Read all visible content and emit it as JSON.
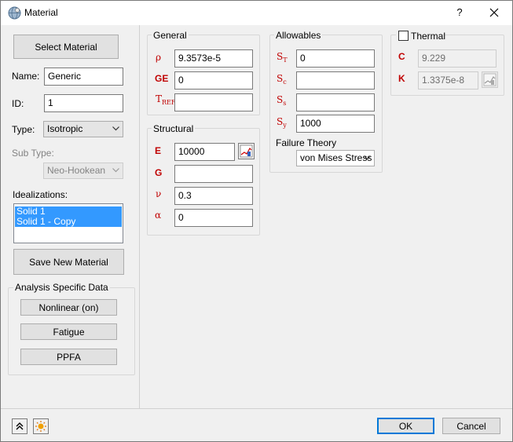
{
  "window": {
    "title": "Material",
    "help_glyph": "?"
  },
  "left": {
    "select_material_label": "Select Material",
    "name_label": "Name:",
    "name_value": "Generic",
    "id_label": "ID:",
    "id_value": "1",
    "type_label": "Type:",
    "type_value": "Isotropic",
    "subtype_label": "Sub Type:",
    "subtype_value": "Neo-Hookean",
    "idealizations_label": "Idealizations:",
    "idealizations": [
      "Solid 1",
      "Solid 1 - Copy"
    ],
    "save_new_material_label": "Save New Material",
    "analysis_group_title": "Analysis Specific Data",
    "nonlinear_label": "Nonlinear (on)",
    "fatigue_label": "Fatigue",
    "ppfa_label": "PPFA"
  },
  "general": {
    "title": "General",
    "rho_symbol": "ρ",
    "rho_value": "9.3573e-5",
    "ge_symbol": "GE",
    "ge_value": "0",
    "tref_symbol": "T",
    "tref_sub": "REF",
    "tref_value": ""
  },
  "structural": {
    "title": "Structural",
    "e_symbol": "E",
    "e_value": "10000",
    "g_symbol": "G",
    "g_value": "",
    "nu_symbol": "ν",
    "nu_value": "0.3",
    "alpha_symbol": "α",
    "alpha_value": "0"
  },
  "allowables": {
    "title": "Allowables",
    "st_symbol": "S",
    "st_sub": "T",
    "st_value": "0",
    "sc_symbol": "S",
    "sc_sub": "c",
    "sc_value": "",
    "ss_symbol": "S",
    "ss_sub": "s",
    "ss_value": "",
    "sy_symbol": "S",
    "sy_sub": "y",
    "sy_value": "1000",
    "failure_theory_label": "Failure Theory",
    "failure_theory_value": "von Mises Stress"
  },
  "thermal": {
    "title": "Thermal",
    "checked": false,
    "c_symbol": "C",
    "c_value": "9.229",
    "k_symbol": "K",
    "k_value": "1.3375e-8"
  },
  "footer": {
    "ok_label": "OK",
    "cancel_label": "Cancel"
  },
  "colors": {
    "symbol_red": "#c00000",
    "selection_blue": "#3399ff",
    "default_button_border": "#0078d7"
  }
}
